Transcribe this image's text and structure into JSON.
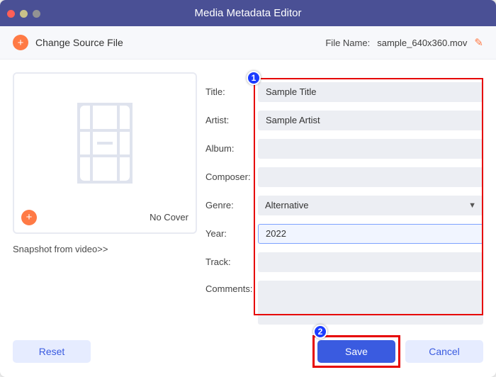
{
  "window": {
    "title": "Media Metadata Editor"
  },
  "toolbar": {
    "change_source": "Change Source File",
    "filename_label": "File Name:",
    "filename_value": "sample_640x360.mov"
  },
  "cover": {
    "no_cover": "No Cover",
    "snapshot": "Snapshot from video>>"
  },
  "fields": {
    "title": {
      "label": "Title:",
      "value": "Sample Title",
      "placeholder": ""
    },
    "artist": {
      "label": "Artist:",
      "value": "Sample Artist",
      "placeholder": ""
    },
    "album": {
      "label": "Album:",
      "value": "",
      "placeholder": ""
    },
    "composer": {
      "label": "Composer:",
      "value": "",
      "placeholder": ""
    },
    "genre": {
      "label": "Genre:",
      "value": "Alternative"
    },
    "year": {
      "label": "Year:",
      "value": "2022",
      "placeholder": ""
    },
    "track": {
      "label": "Track:",
      "value": "",
      "placeholder": ""
    },
    "comments": {
      "label": "Comments:",
      "value": "",
      "placeholder": ""
    }
  },
  "buttons": {
    "reset": "Reset",
    "save": "Save",
    "cancel": "Cancel"
  },
  "annotations": {
    "step1": "1",
    "step2": "2"
  }
}
